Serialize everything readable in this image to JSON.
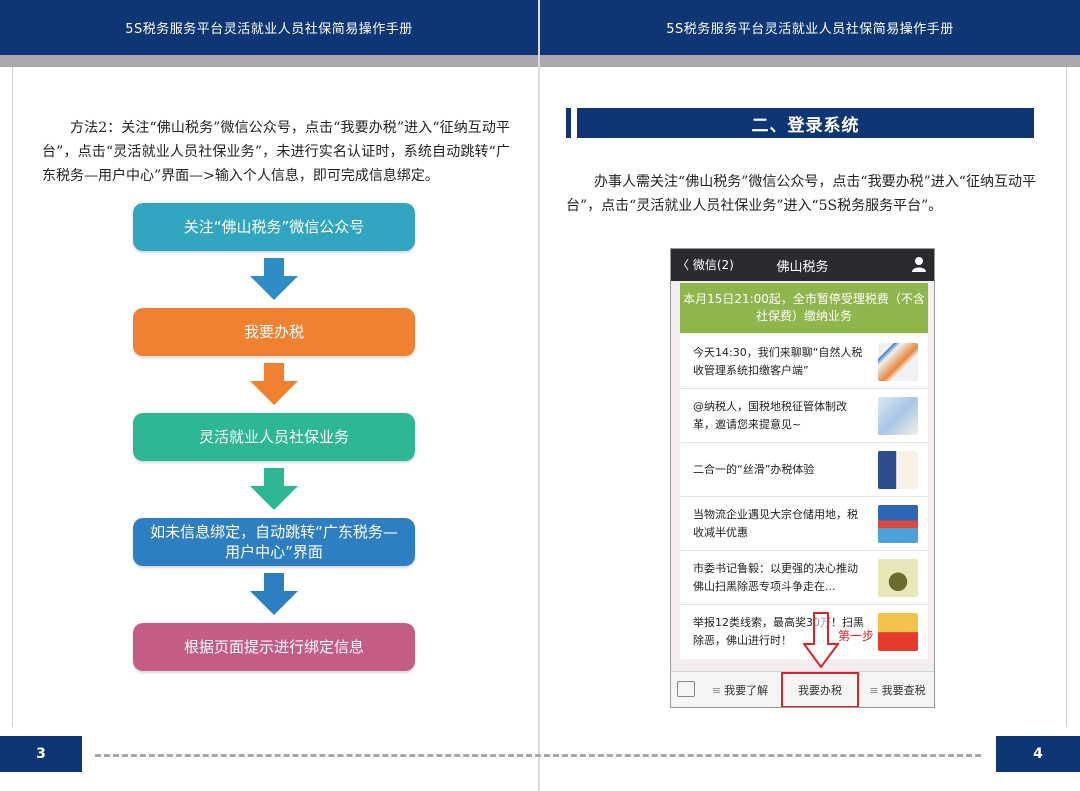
{
  "header": {
    "left_title": "5S税务服务平台灵活就业人员社保简易操作手册",
    "right_title": "5S税务服务平台灵活就业人员社保简易操作手册"
  },
  "left_page": {
    "paragraph": "方法2：关注“佛山税务”微信公众号，点击“我要办税”进入“征纳互动平台”，点击“灵活就业人员社保业务”，未进行实名认证时，系统自动跳转“广东税务—用户中心”界面—>输入个人信息，即可完成信息绑定。",
    "flow": [
      {
        "label": "关注“佛山税务”微信公众号",
        "color": "#32a6c1"
      },
      {
        "label": "我要办税",
        "color": "#ef8130"
      },
      {
        "label": "灵活就业人员社保业务",
        "color": "#2db795"
      },
      {
        "label": "如未信息绑定，自动跳转“广东税务—用户中心”界面",
        "color": "#2d7fc1"
      },
      {
        "label": "根据页面提示进行绑定信息",
        "color": "#c45d86"
      }
    ],
    "arrow_colors": [
      "#2d8dc4",
      "#ef8130",
      "#2db795",
      "#2d7fc1"
    ],
    "page_number": "3"
  },
  "right_page": {
    "section_title": "二、登录系统",
    "paragraph": "办事人需关注“佛山税务”微信公众号，点击“我要办税”进入“征纳互动平台”，点击“灵活就业人员社保业务”进入“5S税务服务平台”。",
    "phone": {
      "back_label": "〈 微信(2)",
      "title": "佛山税务",
      "notice": "本月15日21:00起，全市暂停受理税费（不含社保费）缴纳业务",
      "news": [
        "今天14:30，我们来聊聊“自然人税收管理系统扣缴客户端”",
        "@纳税人，国税地税征管体制改革，邀请您来提意见~",
        "二合一的“丝滑”办税体验",
        "当物流企业遇见大宗仓储用地，税收减半优惠",
        "市委书记鲁毅：以更强的决心推动佛山扫黑除恶专项斗争走在...",
        "举报12类线索，最高奖30万！扫黑除恶，佛山进行时！"
      ],
      "tabs": [
        "我要了解",
        "我要办税",
        "我要查税"
      ],
      "tab_bars": "≡",
      "step_label": "第一步"
    },
    "page_number": "4"
  }
}
